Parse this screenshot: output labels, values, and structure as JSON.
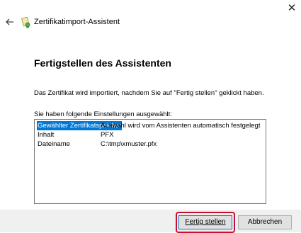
{
  "window": {
    "close_glyph": "✕"
  },
  "header": {
    "title": "Zertifikatimport-Assistent"
  },
  "main": {
    "heading": "Fertigstellen des Assistenten",
    "description": "Das Zertifikat wird importiert, nachdem Sie auf \"Fertig stellen\" geklickt haben.",
    "settings_label": "Sie haben folgende Einstellungen ausgewählt:",
    "settings": [
      {
        "key": "Gewählter Zertifikatspeicher",
        "value": "Auswahl wird vom Assistenten automatisch festgelegt"
      },
      {
        "key": "Inhalt",
        "value": "PFX"
      },
      {
        "key": "Dateiname",
        "value": "C:\\tmp\\xmuster.pfx"
      }
    ]
  },
  "footer": {
    "finish_label": "Fertig stellen",
    "cancel_label": "Abbrechen"
  },
  "colors": {
    "selection": "#0078d7",
    "highlight_ring": "#c8102e"
  }
}
